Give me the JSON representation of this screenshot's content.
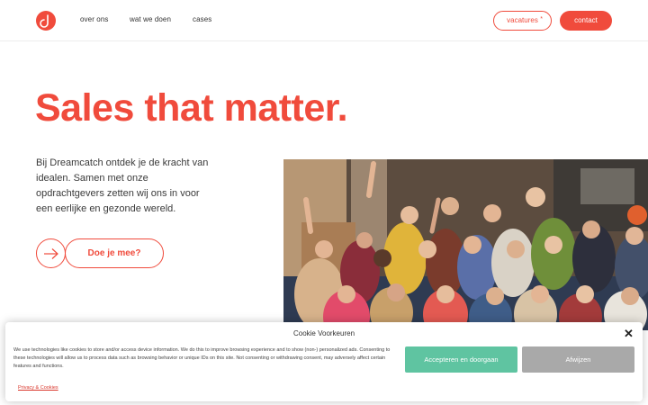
{
  "header": {
    "nav": [
      "over ons",
      "wat we doen",
      "cases"
    ],
    "vacatures_label": "vacatures",
    "vacatures_star": "*",
    "contact_label": "contact",
    "logo_icon": "dreamcatch-logo-icon"
  },
  "hero": {
    "title": "Sales that matter.",
    "text": "Bij Dreamcatch ontdek je de kracht van idealen. Samen met onze opdrachtgevers zetten wij ons in voor een eerlijke en gezonde wereld.",
    "cta_label": "Doe je mee?",
    "arrow_icon": "arrow-right-icon"
  },
  "cookie": {
    "title": "Cookie Voorkeuren",
    "text": "We use technologies like cookies to store and/or access device information. We do this to improve browsing experience and to show (non-) personalized ads. Consenting to these technologies will allow us to process data such as browsing behavior or unique IDs on this site. Not consenting or withdrawing consent, may adversely affect certain features and functions.",
    "accept_label": "Accepteren en doorgaan",
    "decline_label": "Afwijzen",
    "policy_link": "Privacy & Cookies",
    "close_icon": "close-icon"
  },
  "colors": {
    "brand": "#f04b3c",
    "accept": "#5fc4a1",
    "decline": "#a9a9a9"
  }
}
